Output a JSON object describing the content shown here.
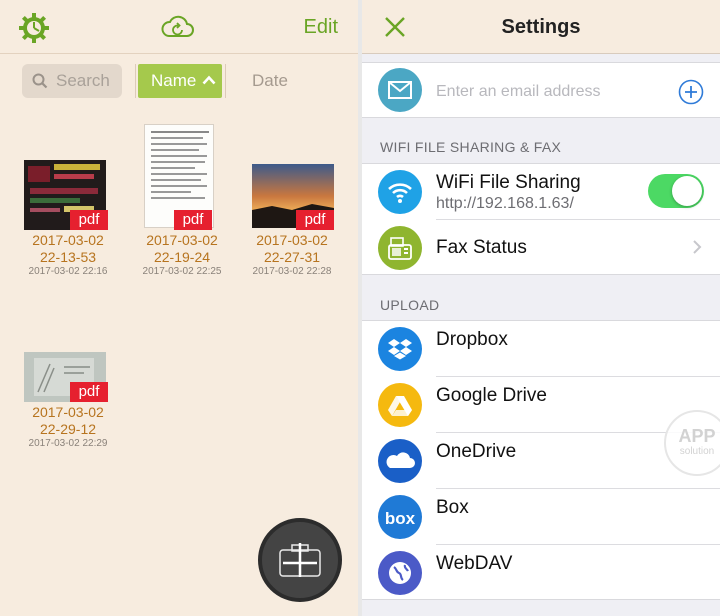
{
  "left": {
    "edit_label": "Edit",
    "search_placeholder": "Search",
    "sort": {
      "name_label": "Name",
      "date_label": "Date",
      "active": "Name",
      "direction": "ascending"
    },
    "files": [
      {
        "name_line1": "2017-03-02",
        "name_line2": "22-13-53",
        "date": "2017-03-02 22:16",
        "badge": "pdf"
      },
      {
        "name_line1": "2017-03-02",
        "name_line2": "22-19-24",
        "date": "2017-03-02 22:25",
        "badge": "pdf"
      },
      {
        "name_line1": "2017-03-02",
        "name_line2": "22-27-31",
        "date": "2017-03-02 22:28",
        "badge": "pdf"
      },
      {
        "name_line1": "2017-03-02",
        "name_line2": "22-29-12",
        "date": "2017-03-02 22:29",
        "badge": "pdf"
      }
    ],
    "icons": {
      "settings": "gear-icon",
      "sync": "cloud-sync-icon",
      "add": "camera-plus-icon"
    }
  },
  "right": {
    "title": "Settings",
    "email": {
      "placeholder": "Enter an email address",
      "value": ""
    },
    "wifi_section": {
      "header": "WIFI FILE SHARING & FAX",
      "wifi_label": "WiFi File Sharing",
      "wifi_url": "http://192.168.1.63/",
      "wifi_enabled": true,
      "fax_label": "Fax Status"
    },
    "upload_section": {
      "header": "UPLOAD",
      "items": [
        {
          "label": "Dropbox",
          "icon": "dropbox-icon"
        },
        {
          "label": "Google Drive",
          "icon": "google-drive-icon"
        },
        {
          "label": "OneDrive",
          "icon": "onedrive-icon"
        },
        {
          "label": "Box",
          "icon": "box-icon"
        },
        {
          "label": "WebDAV",
          "icon": "globe-icon"
        }
      ]
    },
    "watermark": {
      "line1": "APP",
      "line2": "solution"
    }
  },
  "colors": {
    "accent_green": "#6aa525",
    "sort_active": "#a5c94c",
    "pdf_badge": "#e6202f",
    "file_name": "#b7741f",
    "toggle_on": "#4cd964",
    "ios_blue": "#2f7bd8"
  }
}
